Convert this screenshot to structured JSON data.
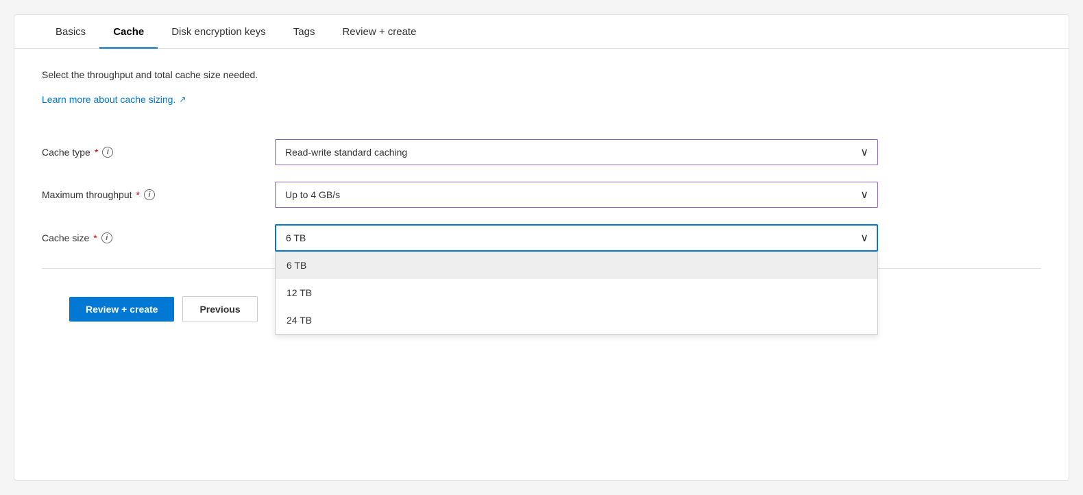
{
  "tabs": [
    {
      "id": "basics",
      "label": "Basics",
      "active": false
    },
    {
      "id": "cache",
      "label": "Cache",
      "active": true
    },
    {
      "id": "disk-encryption-keys",
      "label": "Disk encryption keys",
      "active": false
    },
    {
      "id": "tags",
      "label": "Tags",
      "active": false
    },
    {
      "id": "review-create",
      "label": "Review + create",
      "active": false
    }
  ],
  "description": "Select the throughput and total cache size needed.",
  "link_text": "Learn more about cache sizing.",
  "fields": [
    {
      "id": "cache-type",
      "label": "Cache type",
      "required": true,
      "value": "Read-write standard caching",
      "open": false
    },
    {
      "id": "maximum-throughput",
      "label": "Maximum throughput",
      "required": true,
      "value": "Up to 4 GB/s",
      "open": false
    },
    {
      "id": "cache-size",
      "label": "Cache size",
      "required": true,
      "value": "6 TB",
      "open": true,
      "options": [
        {
          "value": "6 TB",
          "selected": true
        },
        {
          "value": "12 TB",
          "selected": false
        },
        {
          "value": "24 TB",
          "selected": false
        }
      ]
    }
  ],
  "footer": {
    "review_create_label": "Review + create",
    "previous_label": "Previous"
  },
  "icons": {
    "info": "i",
    "chevron": "∨",
    "external_link": "↗"
  }
}
